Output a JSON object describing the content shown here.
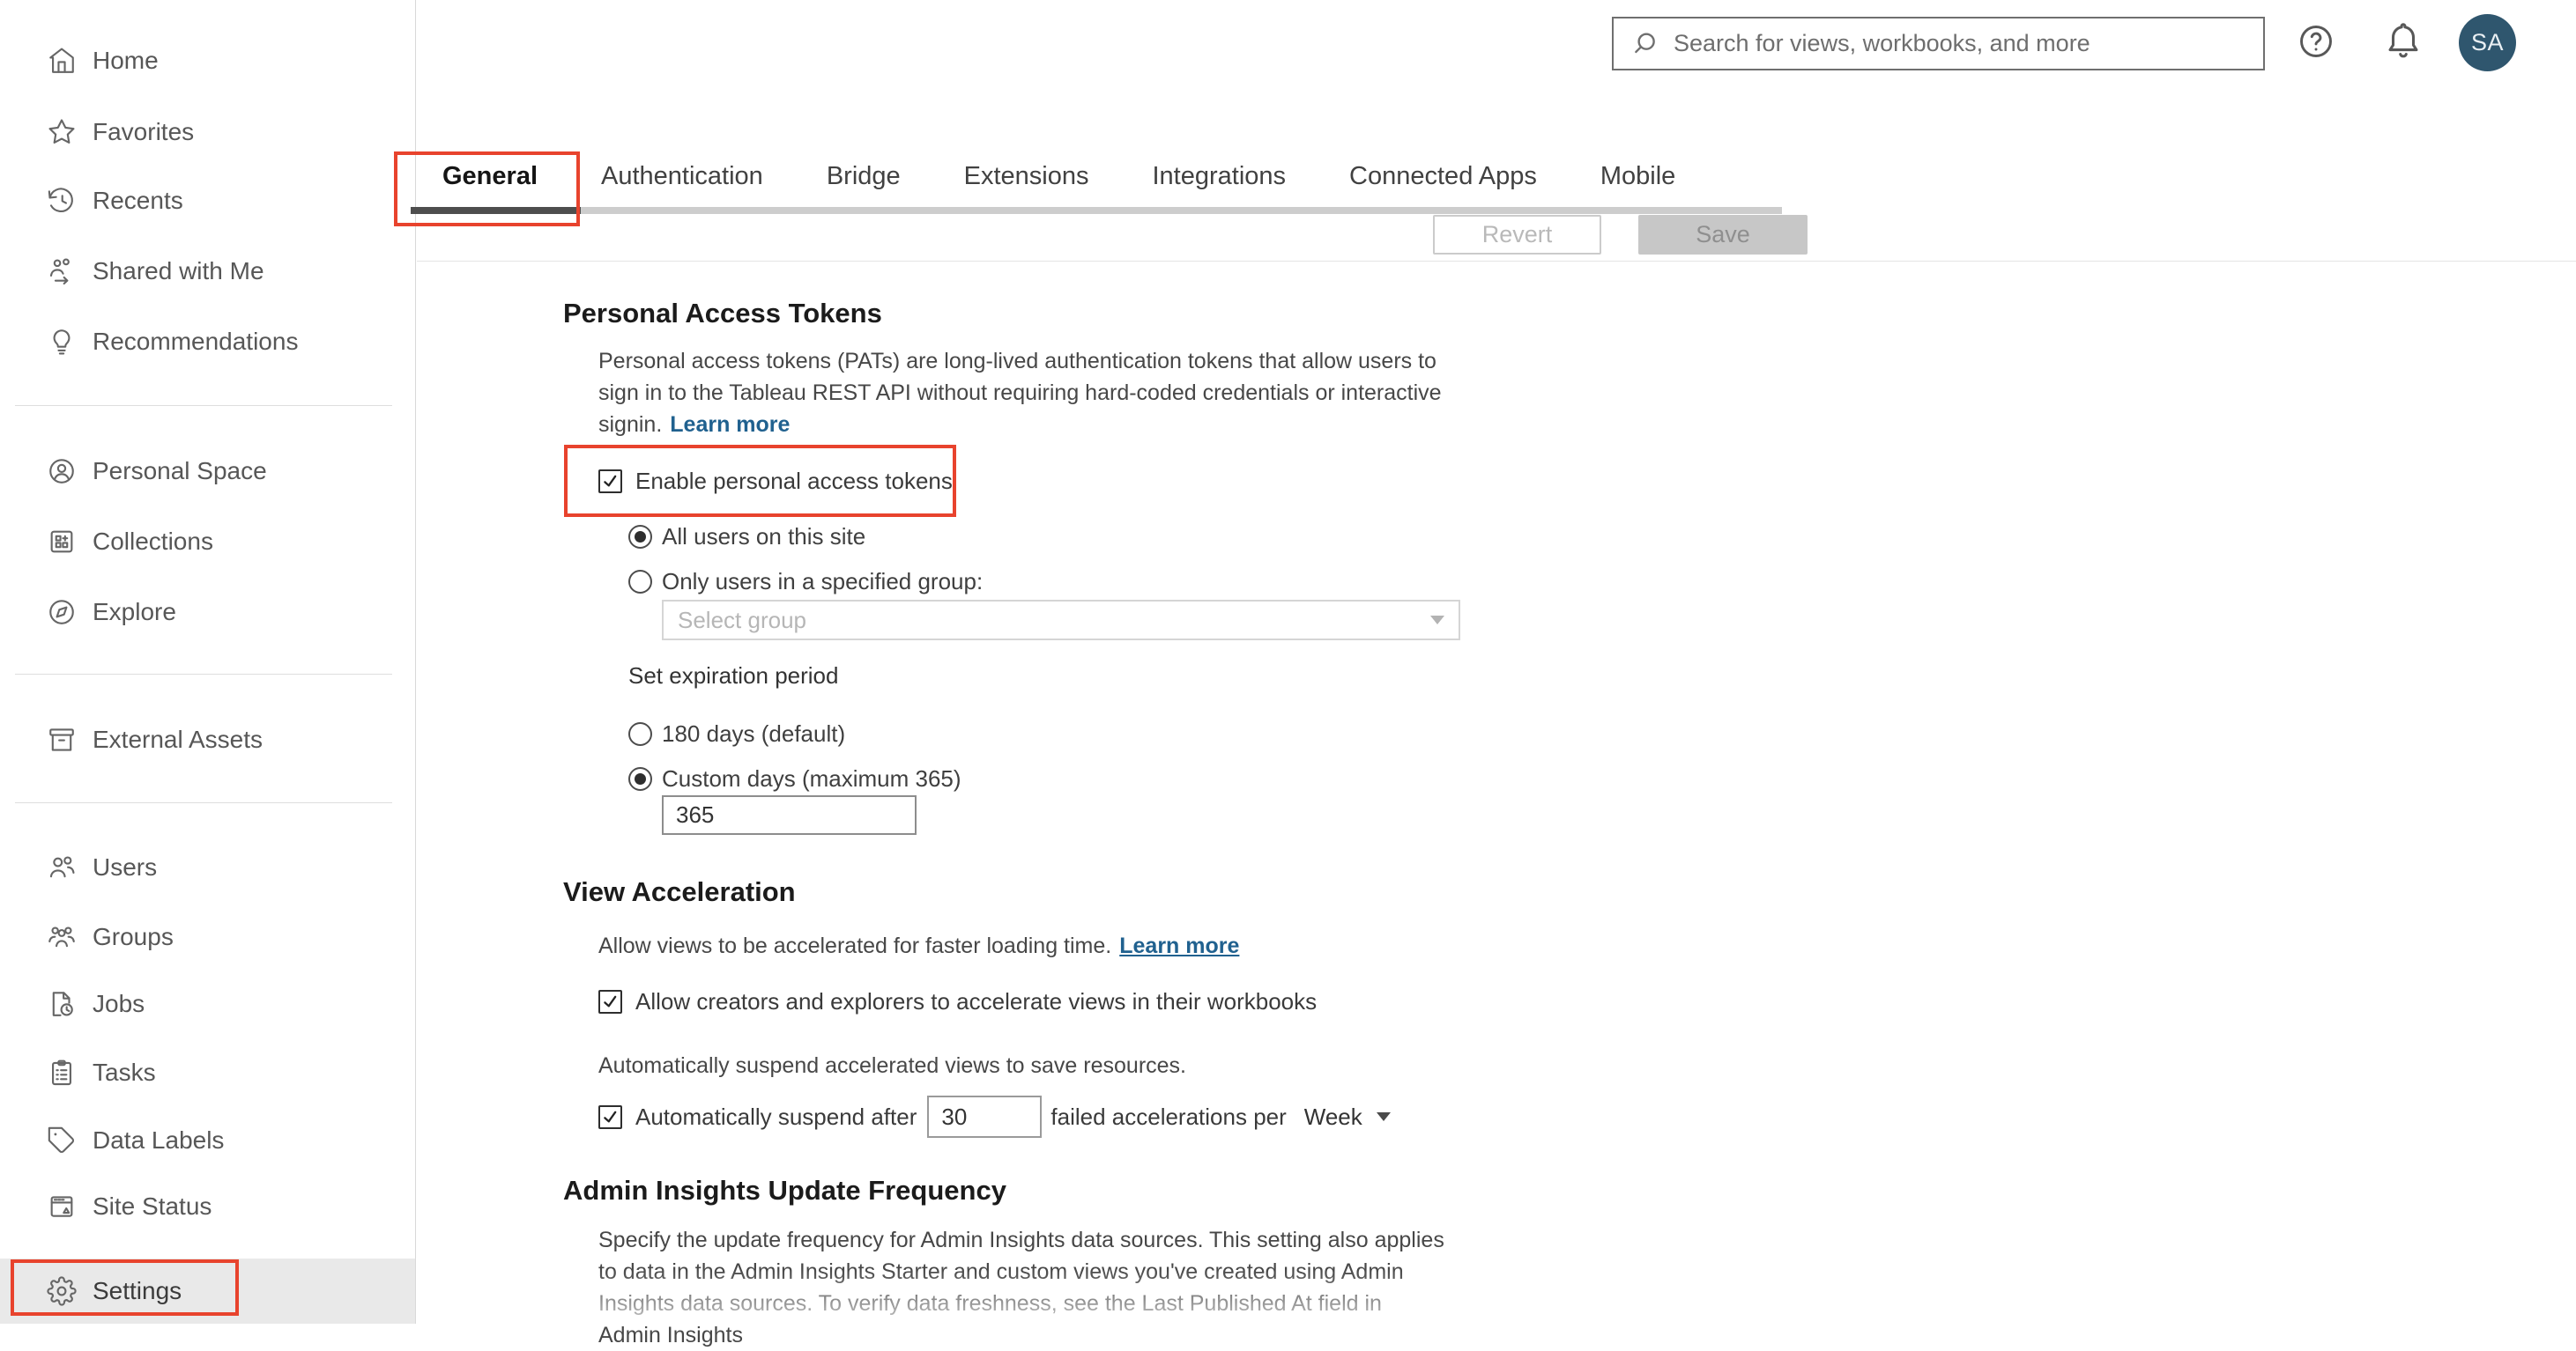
{
  "header": {
    "search_placeholder": "Search for views, workbooks, and more",
    "avatar_initials": "SA"
  },
  "sidebar": {
    "items": [
      {
        "label": "Home"
      },
      {
        "label": "Favorites"
      },
      {
        "label": "Recents"
      },
      {
        "label": "Shared with Me"
      },
      {
        "label": "Recommendations"
      },
      {
        "label": "Personal Space"
      },
      {
        "label": "Collections"
      },
      {
        "label": "Explore"
      },
      {
        "label": "External Assets"
      },
      {
        "label": "Users"
      },
      {
        "label": "Groups"
      },
      {
        "label": "Jobs"
      },
      {
        "label": "Tasks"
      },
      {
        "label": "Data Labels"
      },
      {
        "label": "Site Status"
      },
      {
        "label": "Settings"
      }
    ],
    "selected": "Settings"
  },
  "tabs": {
    "items": [
      {
        "label": "General"
      },
      {
        "label": "Authentication"
      },
      {
        "label": "Bridge"
      },
      {
        "label": "Extensions"
      },
      {
        "label": "Integrations"
      },
      {
        "label": "Connected Apps"
      },
      {
        "label": "Mobile"
      }
    ],
    "selected": "General"
  },
  "toolbar": {
    "revert_label": "Revert",
    "save_label": "Save"
  },
  "sections": {
    "pat": {
      "title": "Personal Access Tokens",
      "description": "Personal access tokens (PATs) are long-lived authentication tokens that allow users to sign in to the Tableau REST API without requiring hard-coded credentials or interactive signin.",
      "learn_more": "Learn more",
      "enable_label": "Enable personal access tokens",
      "enable_checked": true,
      "radio_all_users": "All users on this site",
      "radio_group": "Only users in a specified group:",
      "group_placeholder": "Select group",
      "expiration_label": "Set expiration period",
      "radio_default": "180 days (default)",
      "radio_custom": "Custom days (maximum 365)",
      "custom_days_value": "365"
    },
    "view_accel": {
      "title": "View Acceleration",
      "description": "Allow views to be accelerated for faster loading time.",
      "learn_more": "Learn more",
      "allow_label": "Allow creators and explorers to accelerate views in their workbooks",
      "allow_checked": true,
      "suspend_note": "Automatically suspend accelerated views to save resources.",
      "suspend_prefix": "Automatically suspend after",
      "suspend_value": "30",
      "suspend_suffix": "failed accelerations per",
      "suspend_period": "Week",
      "suspend_checked": true
    },
    "admin_insights": {
      "title": "Admin Insights Update Frequency",
      "description": "Specify the update frequency for Admin Insights data sources. This setting also applies to data in the Admin Insights Starter and custom views you've created using Admin Insights data sources. To verify data freshness, see the Last Published At field in Admin Insights"
    }
  },
  "colors": {
    "annotation_red": "#e8432d",
    "link_blue": "#20618f",
    "avatar_bg": "#2f566e",
    "selected_underline": "#4e4e4e"
  }
}
